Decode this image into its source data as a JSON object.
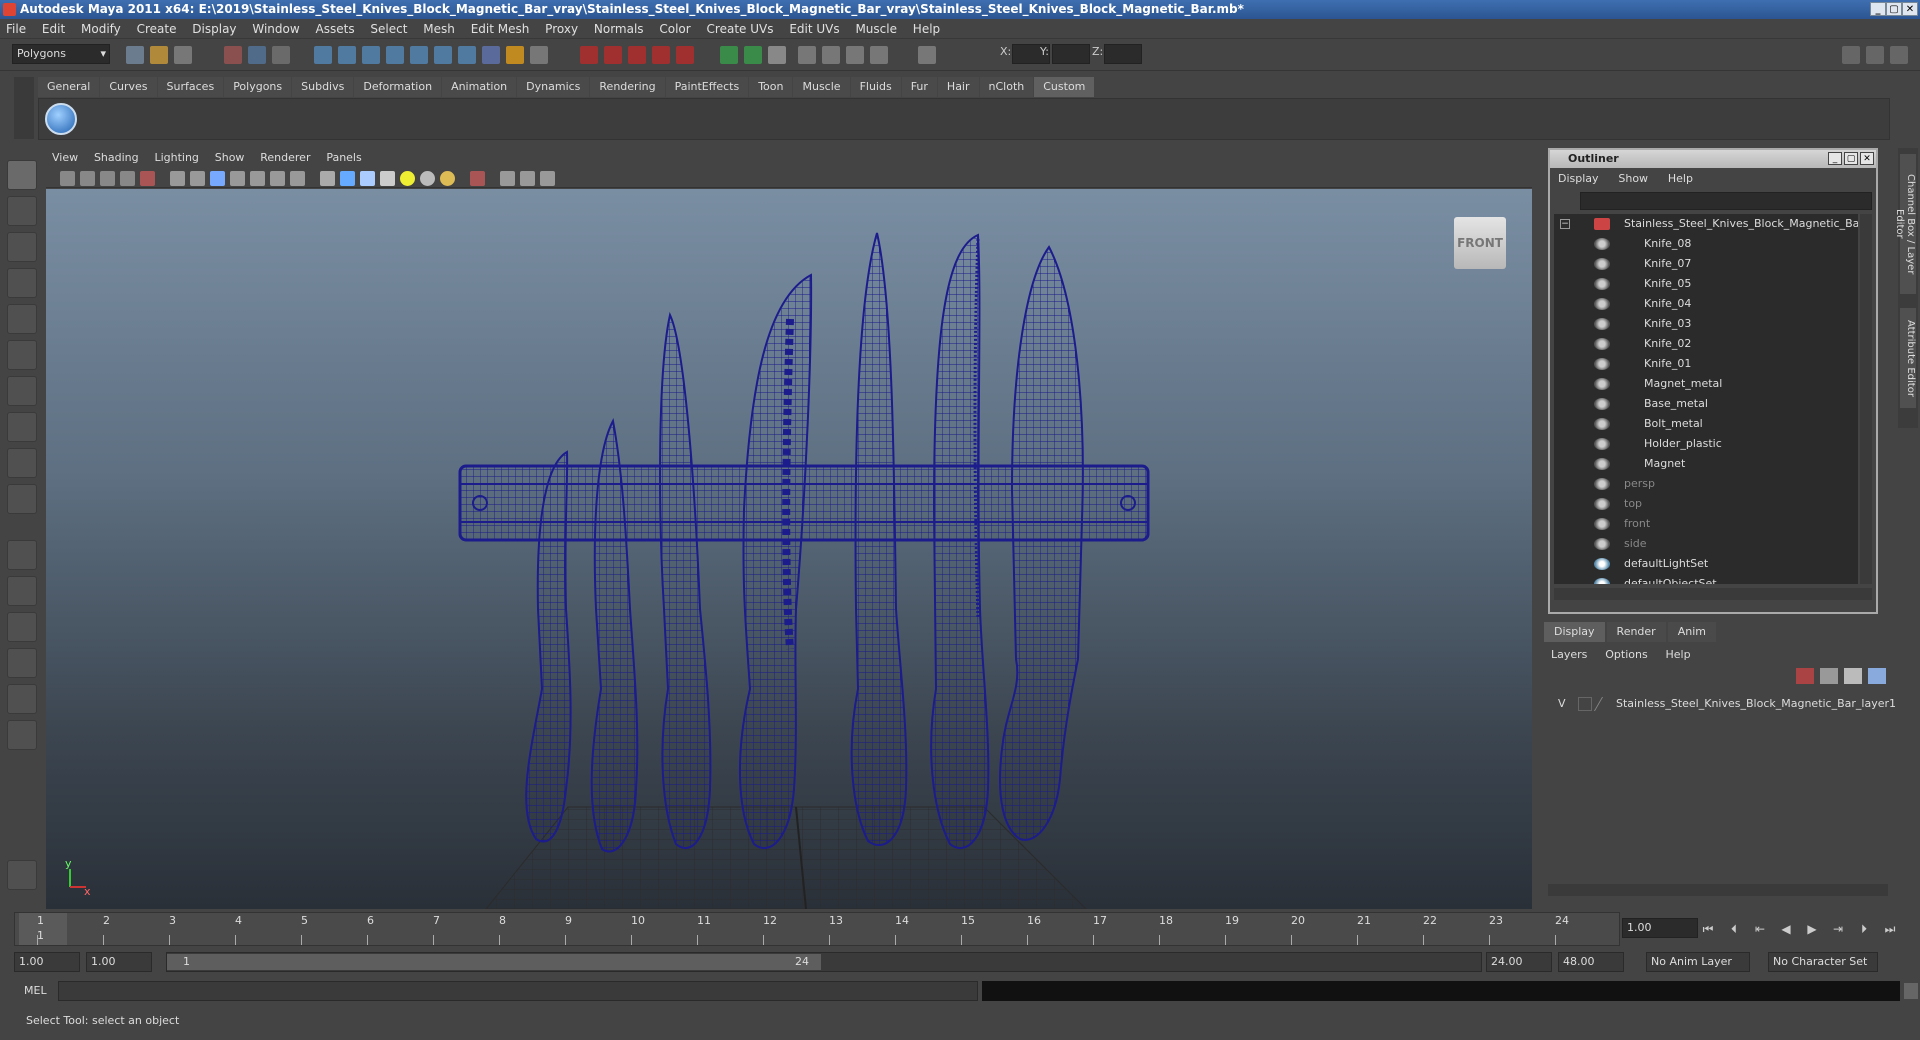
{
  "window": {
    "title": "Autodesk Maya 2011 x64: E:\\2019\\Stainless_Steel_Knives_Block_Magnetic_Bar_vray\\Stainless_Steel_Knives_Block_Magnetic_Bar_vray\\Stainless_Steel_Knives_Block_Magnetic_Bar.mb*"
  },
  "menubar": [
    "File",
    "Edit",
    "Modify",
    "Create",
    "Display",
    "Window",
    "Assets",
    "Select",
    "Mesh",
    "Edit Mesh",
    "Proxy",
    "Normals",
    "Color",
    "Create UVs",
    "Edit UVs",
    "Muscle",
    "Help"
  ],
  "statusline": {
    "mode": "Polygons",
    "x_label": "X:",
    "y_label": "Y:",
    "z_label": "Z:"
  },
  "shelf_tabs": [
    "General",
    "Curves",
    "Surfaces",
    "Polygons",
    "Subdivs",
    "Deformation",
    "Animation",
    "Dynamics",
    "Rendering",
    "PaintEffects",
    "Toon",
    "Muscle",
    "Fluids",
    "Fur",
    "Hair",
    "nCloth",
    "Custom"
  ],
  "shelf_active": "Custom",
  "viewport": {
    "menu": [
      "View",
      "Shading",
      "Lighting",
      "Show",
      "Renderer",
      "Panels"
    ],
    "view_cube_label": "FRONT",
    "axis_y": "y",
    "axis_x": "x"
  },
  "outliner": {
    "title": "Outliner",
    "menu": [
      "Display",
      "Show",
      "Help"
    ],
    "root": "Stainless_Steel_Knives_Block_Magnetic_Bar",
    "children": [
      "Knife_08",
      "Knife_07",
      "Knife_05",
      "Knife_04",
      "Knife_03",
      "Knife_02",
      "Knife_01",
      "Magnet_metal",
      "Base_metal",
      "Bolt_metal",
      "Holder_plastic",
      "Magnet"
    ],
    "others": [
      "persp",
      "top",
      "front",
      "side",
      "defaultLightSet",
      "defaultObjectSet"
    ]
  },
  "layer_editor": {
    "tabs": [
      "Display",
      "Render",
      "Anim"
    ],
    "menu": [
      "Layers",
      "Options",
      "Help"
    ],
    "layer_visibility": "V",
    "layer_name": "Stainless_Steel_Knives_Block_Magnetic_Bar_layer1"
  },
  "right_tabs": [
    "Channel Box / Layer Editor",
    "Attribute Editor"
  ],
  "timeline": {
    "ticks": [
      "1",
      "2",
      "3",
      "4",
      "5",
      "6",
      "7",
      "8",
      "9",
      "10",
      "11",
      "12",
      "13",
      "14",
      "15",
      "16",
      "17",
      "18",
      "19",
      "20",
      "21",
      "22",
      "23",
      "24"
    ],
    "current_frame": "1.00",
    "playhead": "1"
  },
  "range": {
    "start": "1.00",
    "playback_start": "1.00",
    "slider_start": "1",
    "slider_end": "24",
    "playback_end": "24.00",
    "end": "48.00",
    "anim_layer": "No Anim Layer",
    "character_set": "No Character Set"
  },
  "command_line": {
    "label": "MEL"
  },
  "status": {
    "help": "Select Tool: select an object"
  }
}
